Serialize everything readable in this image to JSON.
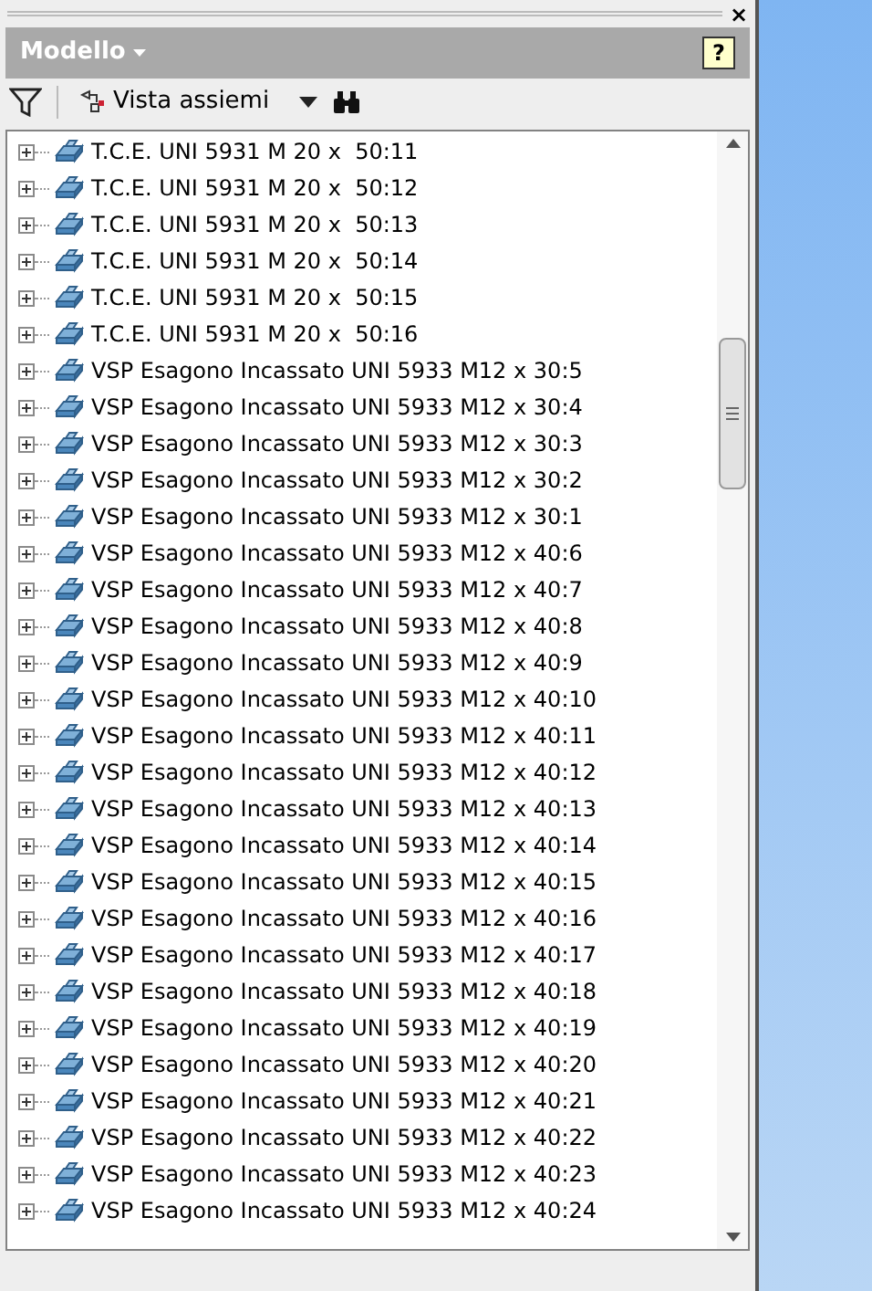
{
  "panel": {
    "close": "×",
    "title": "Modello",
    "help": "?"
  },
  "toolbar": {
    "view_label": "Vista assiemi"
  },
  "tree": {
    "items": [
      {
        "label": "T.C.E. UNI 5931 M 20 x  50:11"
      },
      {
        "label": "T.C.E. UNI 5931 M 20 x  50:12"
      },
      {
        "label": "T.C.E. UNI 5931 M 20 x  50:13"
      },
      {
        "label": "T.C.E. UNI 5931 M 20 x  50:14"
      },
      {
        "label": "T.C.E. UNI 5931 M 20 x  50:15"
      },
      {
        "label": "T.C.E. UNI 5931 M 20 x  50:16"
      },
      {
        "label": "VSP Esagono Incassato UNI 5933 M12 x 30:5"
      },
      {
        "label": "VSP Esagono Incassato UNI 5933 M12 x 30:4"
      },
      {
        "label": "VSP Esagono Incassato UNI 5933 M12 x 30:3"
      },
      {
        "label": "VSP Esagono Incassato UNI 5933 M12 x 30:2"
      },
      {
        "label": "VSP Esagono Incassato UNI 5933 M12 x 30:1"
      },
      {
        "label": "VSP Esagono Incassato UNI 5933 M12 x 40:6"
      },
      {
        "label": "VSP Esagono Incassato UNI 5933 M12 x 40:7"
      },
      {
        "label": "VSP Esagono Incassato UNI 5933 M12 x 40:8"
      },
      {
        "label": "VSP Esagono Incassato UNI 5933 M12 x 40:9"
      },
      {
        "label": "VSP Esagono Incassato UNI 5933 M12 x 40:10"
      },
      {
        "label": "VSP Esagono Incassato UNI 5933 M12 x 40:11"
      },
      {
        "label": "VSP Esagono Incassato UNI 5933 M12 x 40:12"
      },
      {
        "label": "VSP Esagono Incassato UNI 5933 M12 x 40:13"
      },
      {
        "label": "VSP Esagono Incassato UNI 5933 M12 x 40:14"
      },
      {
        "label": "VSP Esagono Incassato UNI 5933 M12 x 40:15"
      },
      {
        "label": "VSP Esagono Incassato UNI 5933 M12 x 40:16"
      },
      {
        "label": "VSP Esagono Incassato UNI 5933 M12 x 40:17"
      },
      {
        "label": "VSP Esagono Incassato UNI 5933 M12 x 40:18"
      },
      {
        "label": "VSP Esagono Incassato UNI 5933 M12 x 40:19"
      },
      {
        "label": "VSP Esagono Incassato UNI 5933 M12 x 40:20"
      },
      {
        "label": "VSP Esagono Incassato UNI 5933 M12 x 40:21"
      },
      {
        "label": "VSP Esagono Incassato UNI 5933 M12 x 40:22"
      },
      {
        "label": "VSP Esagono Incassato UNI 5933 M12 x 40:23"
      },
      {
        "label": "VSP Esagono Incassato UNI 5933 M12 x 40:24"
      }
    ]
  }
}
